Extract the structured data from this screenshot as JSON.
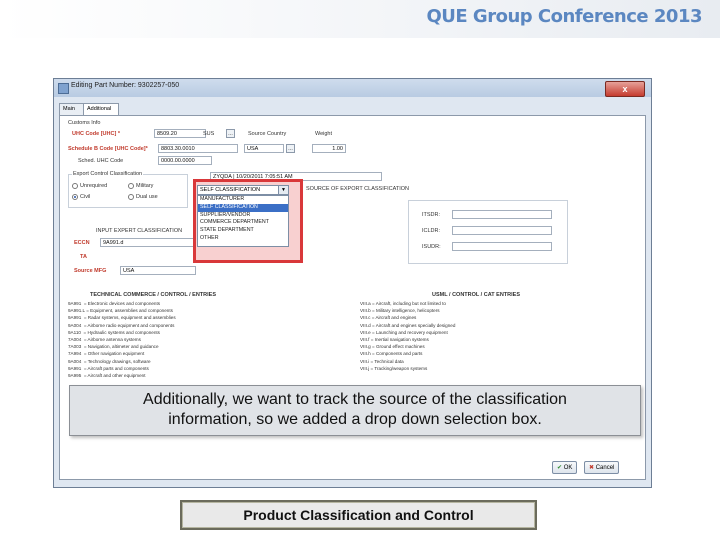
{
  "slide": {
    "header_title": "QUE Group Conference 2013",
    "footer_title": "Product Classification and Control",
    "callout": {
      "line1": "Additionally, we want to track the source of the classification",
      "line2": "information, so we added a drop down selection box."
    }
  },
  "window": {
    "title": "Editing Part Number: 9302257-050",
    "close_glyph": "x",
    "tabs": [
      {
        "label": "Main"
      },
      {
        "label": "Additional"
      }
    ]
  },
  "form": {
    "customs_info_label": "Customs Info",
    "uhc_label": "UHC Code [UHC] *",
    "uhc_value": "8509.20",
    "uhc_unit": "SUS",
    "country_label": "Source Country",
    "weight_label": "Weight",
    "country_value": "USA",
    "weight_value": "1.00",
    "schedule_b_label": "Schedule B Code [UHC Code]*",
    "schedule_b_value": "8803.30.0010",
    "sched_uhc_label": "Sched. UHC Code",
    "sched_uhc_value": "0000.00.0000",
    "export_classification_label": "Export Control Classification",
    "radios": [
      {
        "label": "Unrequired",
        "checked": false
      },
      {
        "label": "Military",
        "checked": false
      },
      {
        "label": "Civil",
        "checked": true
      },
      {
        "label": "Dual use",
        "checked": false
      }
    ],
    "classification_date_value": "ZYQDA | 10/20/2011 7:05:51 AM",
    "source_label": "SOURCE OF EXPORT CLASSIFICATION",
    "input_export_label": "INPUT EXPERT CLASSIFICATION",
    "eccn_label": "ECCN",
    "eccn_value": "9A991.d",
    "ta_label": "TA",
    "source_mfg_label": "Source MFG",
    "source_mfg_value": "USA",
    "right_labels": [
      "ITSDR:",
      "ICLDR:",
      "ISUDR:"
    ],
    "dropdown_value": "SELF CLASSIFICATION",
    "dropdown_options": [
      {
        "label": "MANUFACTURER",
        "selected": false
      },
      {
        "label": "SELF CLASSIFICATION",
        "selected": true
      },
      {
        "label": "SUPPLIER/VENDOR",
        "selected": false
      },
      {
        "label": "COMMERCE DEPARTMENT",
        "selected": false
      },
      {
        "label": "STATE DEPARTMENT",
        "selected": false
      },
      {
        "label": "OTHER",
        "selected": false
      }
    ],
    "commerce_header": "TECHNICAL COMMERCE / CONTROL / ENTRIES",
    "commerce_lines": "9A991  = Electronic devices and components\n9A991.L = Equipment, assemblies and components\n9A991  = Radar systems, equipment and assemblies\n9A004  = Airborne radio equipment and components\n9A110  = Hydraulic systems and components\n7A004  = Airborne antenna systems\n7A003  = Navigation, altimeter and guidance\n7A994  = Other navigation equipment\n9A004  = Technology drawings, software\n9A991  = Aircraft parts and components\n9A995  = Aircraft and other equipment",
    "usml_header": "USML / CONTROL / CAT ENTRIES",
    "usml_lines": "VIII.a = Aircraft, including but not limited to\nVIII.b = Military intelligence, helicopters\nVIII.c = Aircraft and engines\nVIII.d = Aircraft and engines specially designed\nVIII.e = Launching and recovery equipment\nVIII.f = Inertial navigation systems\nVIII.g = Ground effect machines\nVIII.h = Components and parts\nVIII.i = Technical data\nVIII.j = Tracking/weapon systems"
  },
  "buttons": {
    "ok": "OK",
    "cancel": "Cancel"
  }
}
